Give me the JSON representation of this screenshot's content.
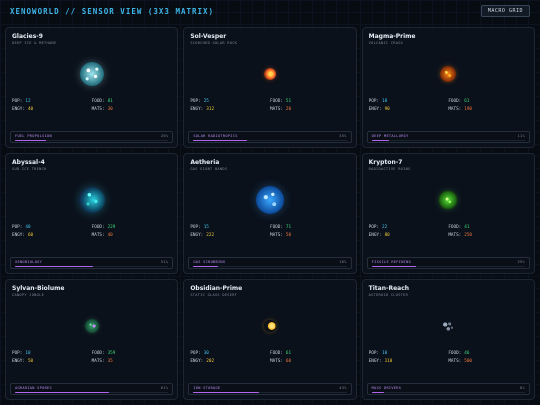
{
  "header": {
    "title": "XENOWORLD // SENSOR VIEW (3X3 MATRIX)",
    "button": "MACRO GRID"
  },
  "labels": {
    "pop": "POP:",
    "food": "FOOD:",
    "engy": "ENGY:",
    "mats": "MATS:"
  },
  "planets": [
    {
      "name": "Glacies-9",
      "type": "DEEP ICE & METHANE",
      "pop": "12",
      "food": "81",
      "engy": "40",
      "mats": "30",
      "tech": "FUEL PROPULSION",
      "tech_pct": "20%",
      "progress": 0.2,
      "color": "#9fe7f0",
      "style": "ice",
      "size": 24
    },
    {
      "name": "Sol-Vesper",
      "type": "SCORCHED SOLAR ROCK",
      "pop": "25",
      "food": "51",
      "engy": "312",
      "mats": "20",
      "tech": "SOLAR RADIOTROPICS",
      "tech_pct": "35%",
      "progress": 0.35,
      "color": "#ff6a2a",
      "style": "sun",
      "size": 12
    },
    {
      "name": "Magma-Prime",
      "type": "VOLCANIC CRAGS",
      "pop": "18",
      "food": "61",
      "engy": "90",
      "mats": "190",
      "tech": "DEEP METALLURGY",
      "tech_pct": "11%",
      "progress": 0.11,
      "color": "#ff8c1a",
      "style": "magma",
      "size": 16
    },
    {
      "name": "Abyssal-4",
      "type": "SUB-ICE TRENCH",
      "pop": "40",
      "food": "229",
      "engy": "60",
      "mats": "40",
      "tech": "XENOBIOLOGY",
      "tech_pct": "51%",
      "progress": 0.51,
      "color": "#2ad0e0",
      "style": "abyss",
      "size": 26
    },
    {
      "name": "Aetheria",
      "type": "GAS GIANT BANDS",
      "pop": "15",
      "food": "71",
      "engy": "222",
      "mats": "50",
      "tech": "GAS SCRUBBING",
      "tech_pct": "16%",
      "progress": 0.16,
      "color": "#3aa8ff",
      "style": "gas",
      "size": 28
    },
    {
      "name": "Krypton-7",
      "type": "RADIOACTIVE RUINS",
      "pop": "22",
      "food": "41",
      "engy": "80",
      "mats": "250",
      "tech": "FISSILE REFINING",
      "tech_pct": "29%",
      "progress": 0.29,
      "color": "#5ae03a",
      "style": "radio",
      "size": 18
    },
    {
      "name": "Sylvan-Biolume",
      "type": "CANOPY JUNGLE",
      "pop": "18",
      "food": "359",
      "engy": "50",
      "mats": "35",
      "tech": "AGRARIAN SPORES",
      "tech_pct": "61%",
      "progress": 0.61,
      "color": "#3aa06a",
      "style": "jungle",
      "size": 14
    },
    {
      "name": "Obsidian-Prime",
      "type": "STATIC GLASS DESERT",
      "pop": "30",
      "food": "61",
      "engy": "202",
      "mats": "60",
      "tech": "ION STORAGE",
      "tech_pct": "43%",
      "progress": 0.43,
      "color": "#ffb21a",
      "style": "obsidian",
      "size": 12
    },
    {
      "name": "Titan-Reach",
      "type": "ASTEROID CLUSTER",
      "pop": "10",
      "food": "46",
      "engy": "110",
      "mats": "500",
      "tech": "MASS DRIVERS",
      "tech_pct": "8%",
      "progress": 0.08,
      "color": "#7c8a9e",
      "style": "asteroid",
      "size": 14
    }
  ]
}
